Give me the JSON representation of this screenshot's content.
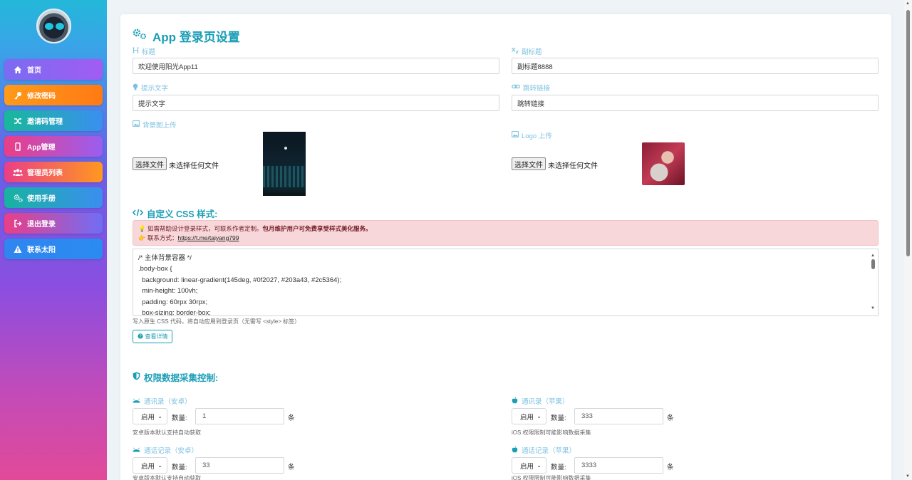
{
  "sidebar": {
    "items": [
      {
        "label": "首页",
        "icon": "home-icon"
      },
      {
        "label": "修改密码",
        "icon": "key-icon"
      },
      {
        "label": "邀请码管理",
        "icon": "shuffle-icon"
      },
      {
        "label": "App管理",
        "icon": "mobile-icon"
      },
      {
        "label": "管理员列表",
        "icon": "users-icon"
      },
      {
        "label": "使用手册",
        "icon": "cogs-icon"
      },
      {
        "label": "退出登录",
        "icon": "sign-out-icon"
      },
      {
        "label": "联系太阳",
        "icon": "warning-icon"
      }
    ]
  },
  "page": {
    "title": "App 登录页设置"
  },
  "form": {
    "title_label": "标题",
    "title_value": "欢迎使用阳光App11",
    "subtitle_label": "副标题",
    "subtitle_value": "副标题8888",
    "hint_label": "提示文字",
    "hint_value": "提示文字",
    "link_label": "跳转链接",
    "link_value": "跳转链接",
    "bg_upload_label": "背景图上传",
    "logo_upload_label": "Logo 上传",
    "choose_file": "选择文件",
    "no_file": "未选择任何文件"
  },
  "css_section": {
    "title": "自定义 CSS 样式:",
    "notice_line1_a": "如需帮助设计登录样式，可联系作者定制。",
    "notice_line1_b": "包月维护用户可免费享受样式美化服务。",
    "notice_line2_a": "联系方式：",
    "notice_line2_link": "https://t.me/taiyang799",
    "code_lines": [
      "/* 主体背景容器 */",
      ".body-box {",
      "  background: linear-gradient(145deg, #0f2027, #203a43, #2c5364);",
      "  min-height: 100vh;",
      "  padding: 60rpx 30rpx;",
      "  box-sizing: border-box;"
    ],
    "help_text": "写入原生 CSS 代码，将自动应用到登录页（无需写 <style> 标签）",
    "detail_button": "查看详情"
  },
  "permissions": {
    "title": "权限数据采集控制:",
    "count_label": "数量:",
    "unit": "条",
    "items": [
      {
        "label": "通讯录（安卓）",
        "status": "启用",
        "count": "1",
        "note": "安卓版本默认支持自动获取",
        "icon": "android-icon"
      },
      {
        "label": "通讯录（苹果）",
        "status": "启用",
        "count": "333",
        "note": "iOS 权限限制可能影响数据采集",
        "icon": "apple-icon"
      },
      {
        "label": "通话记录（安卓）",
        "status": "启用",
        "count": "33",
        "note": "安卓版本默认支持自动获取",
        "icon": "android-icon"
      },
      {
        "label": "通话记录（苹果）",
        "status": "启用",
        "count": "3333",
        "note": "iOS 权限限制可能影响数据采集",
        "icon": "apple-icon"
      }
    ]
  },
  "colors": {
    "accent": "#1a9db6",
    "label": "#7cc0e0",
    "notice_bg": "#f8d7da"
  }
}
